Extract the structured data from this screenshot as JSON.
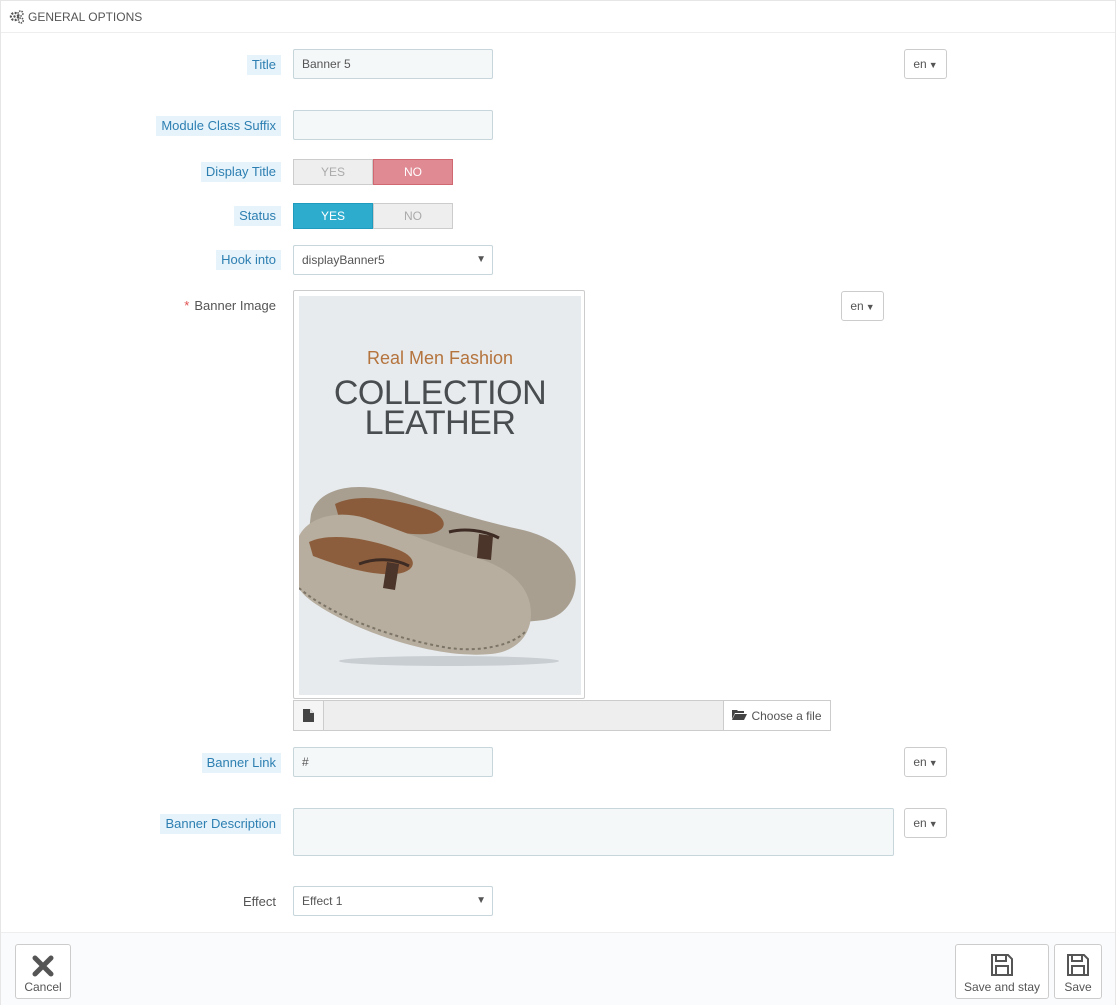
{
  "panel": {
    "heading": "GENERAL OPTIONS",
    "heading_icon": "gears-icon"
  },
  "fields": {
    "title": {
      "label": "Title",
      "value": "Banner 5",
      "lang": "en"
    },
    "module_class_suffix": {
      "label": "Module Class Suffix",
      "value": ""
    },
    "display_title": {
      "label": "Display Title",
      "yes": "YES",
      "no": "NO",
      "selected": "NO"
    },
    "status": {
      "label": "Status",
      "yes": "YES",
      "no": "NO",
      "selected": "YES"
    },
    "hook_into": {
      "label": "Hook into",
      "selected": "displayBanner5"
    },
    "banner_image": {
      "label": "Banner Image",
      "required_mark": "*",
      "lang": "en",
      "image_text": {
        "subtitle": "Real Men Fashion",
        "line1": "COLLECTION",
        "line2": "LEATHER"
      },
      "file_name": "",
      "choose_label": "Choose a file"
    },
    "banner_link": {
      "label": "Banner Link",
      "value": "#",
      "lang": "en"
    },
    "banner_description": {
      "label": "Banner Description",
      "value": "",
      "lang": "en"
    },
    "effect": {
      "label": "Effect",
      "selected": "Effect 1"
    }
  },
  "footer": {
    "cancel": "Cancel",
    "save_and_stay": "Save and stay",
    "save": "Save"
  },
  "colors": {
    "label_bg": "#e6f3fa",
    "label_text": "#2d7fb2",
    "switch_yes_on": "#2eacce",
    "switch_no_on": "#e08a94",
    "required": "#e05050"
  }
}
